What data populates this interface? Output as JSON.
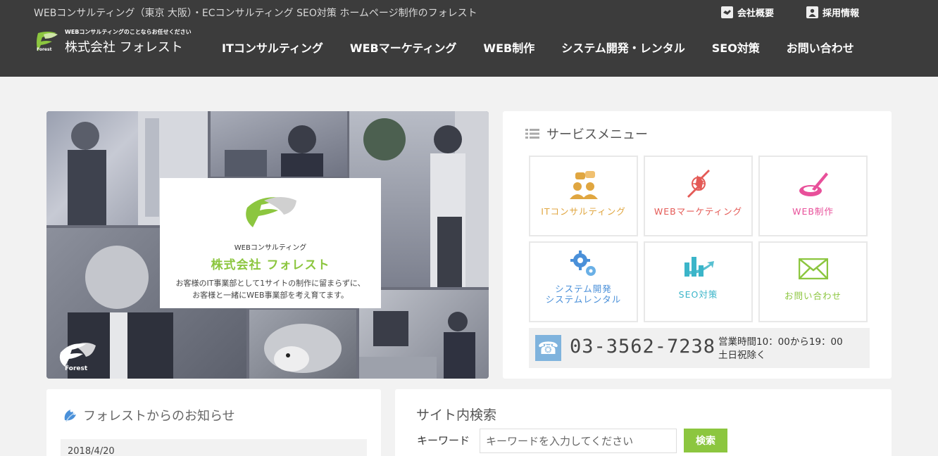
{
  "header": {
    "tagline": "WEBコンサルティング（東京 大阪）・ECコンサルティング SEO対策 ホームページ制作のフォレスト",
    "top_links": [
      {
        "label": "会社概要",
        "icon": "handshake-icon"
      },
      {
        "label": "採用情報",
        "icon": "person-icon"
      }
    ],
    "logo": {
      "small": "WEBコンサルティングのことならお任せください",
      "name": "株式会社 フォレスト",
      "mark_text": "Forest"
    },
    "nav": [
      "ITコンサルティング",
      "WEBマーケティング",
      "WEB制作",
      "システム開発・レンタル",
      "SEO対策",
      "お問い合わせ"
    ]
  },
  "hero": {
    "sub": "WEBコンサルティング",
    "name": "株式会社 フォレスト",
    "desc1": "お客様のIT事業部として1サイトの制作に留まらずに、",
    "desc2": "お客様と一緒にWEB事業部を考え育てます。",
    "mark_text": "Forest"
  },
  "service": {
    "title": "サービスメニュー",
    "items": [
      {
        "label": "ITコンサルティング",
        "color": "#e0a640",
        "icon": "consulting-people-icon"
      },
      {
        "label": "WEBマーケティング",
        "color": "#e45a56",
        "icon": "globe-arrows-icon"
      },
      {
        "label": "WEB制作",
        "color": "#e8509a",
        "icon": "paint-brush-icon"
      },
      {
        "label": "システム開発\nシステムレンタル",
        "line1": "システム開発",
        "line2": "システムレンタル",
        "color": "#4a90d9",
        "icon": "gears-icon"
      },
      {
        "label": "SEO対策",
        "color": "#3bb5c9",
        "icon": "rising-chart-icon"
      },
      {
        "label": "お問い合わせ",
        "color": "#8cc63f",
        "icon": "mail-envelope-icon"
      }
    ],
    "phone": {
      "number": "03-3562-7238",
      "hours1": "営業時間10：00から19：00",
      "hours2": "土日祝除く"
    }
  },
  "news": {
    "title": "フォレストからのお知らせ",
    "items": [
      {
        "date": "2018/4/20"
      }
    ]
  },
  "search": {
    "title": "サイト内検索",
    "keyword_label": "キーワード",
    "placeholder": "キーワードを入力してください",
    "button": "検索"
  },
  "colors": {
    "header_bg": "#3c3c3c",
    "brand_green": "#8cc63f",
    "page_bg": "#f2f2f2"
  }
}
